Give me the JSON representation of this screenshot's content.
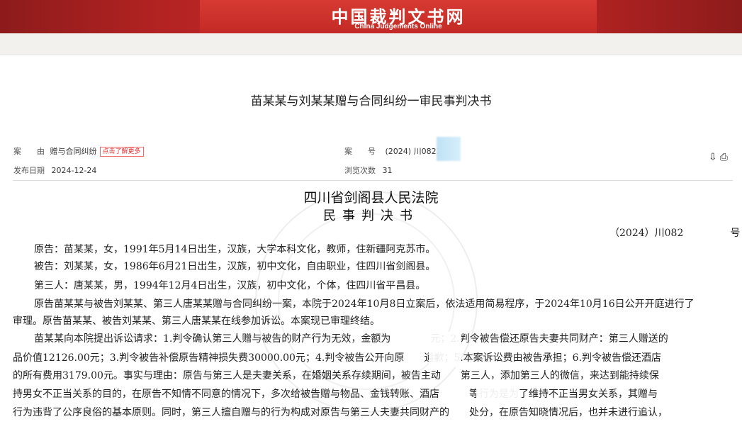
{
  "banner": {
    "title": "中国裁判文书网",
    "subtitle": "China Judgements Online"
  },
  "document": {
    "title": "苗某某与刘某某赠与合同纠纷一审民事判决书"
  },
  "meta": {
    "cause_label": "案　　由",
    "cause_value": "赠与合同纠纷",
    "cause_tag": "点击了解更多",
    "caseno_label": "案　　号",
    "caseno_value": "(2024) 川0823",
    "date_label": "发布日期",
    "date_value": "2024-12-24",
    "views_label": "浏览次数",
    "views_value": "31"
  },
  "tools": {
    "download_icon": "download-icon",
    "print_icon": "print-icon"
  },
  "court": {
    "name": "四川省剑阁县人民法院",
    "doctype": "民事判决书",
    "caseno_left": "（2024）川082",
    "caseno_right": "号"
  },
  "body": {
    "line1": "原告：苗某某，女，1991年5月14日出生，汉族，大学本科文化，教师，住新疆阿克苏市。",
    "line2": "被告：刘某某，女，1986年6月21日出生，汉族，初中文化，自由职业，住四川省剑阁县。",
    "line3": "第三人：唐某某，男，1994年12月4日出生，汉族，初中文化，个体，住四川省平昌县。",
    "line4": "原告苗某某与被告刘某某、第三人唐某某赠与合同纠纷一案，本院于2024年10月8日立案后，依法适用简易程序，于2024年10月16日公开开庭进行了",
    "line5": "审理。原告苗某某、被告刘某某、第三人唐某某在线参加诉讼。本案现已审理终结。",
    "line6": "苗某某向本院提出诉讼请求：1.判令确认第三人赠与被告的财产行为无效，金额为　　　　元；2.判令被告偿还原告夫妻共同财产：第三人赠送的",
    "line7": "品价值12126.00元；3.判令被告补偿原告精神损失费30000.00元；4.判令被告公开向原　　道歉；5.本案诉讼费由被告承担；6.判令被告偿还酒店",
    "line8": "的所有费用3179.00元。事实与理由：原告与第三人是夫妻关系，在婚姻关系存续期间，被告主动　　第三人，添加第三人的微信，来达到能持续保",
    "line9": "持男女不正当关系的目的，在原告不知情不同意的情况下，多次给被告赠与物品、金钱转账、酒店　　　等行为是为了维持不正当男女关系，其赠与",
    "line10": "行为违背了公序良俗的基本原则。同时，第三人擅自赠与的行为构成对原告与第三人夫妻共同财产的　　处分，在原告知晓情况后，也并未进行追认，"
  }
}
